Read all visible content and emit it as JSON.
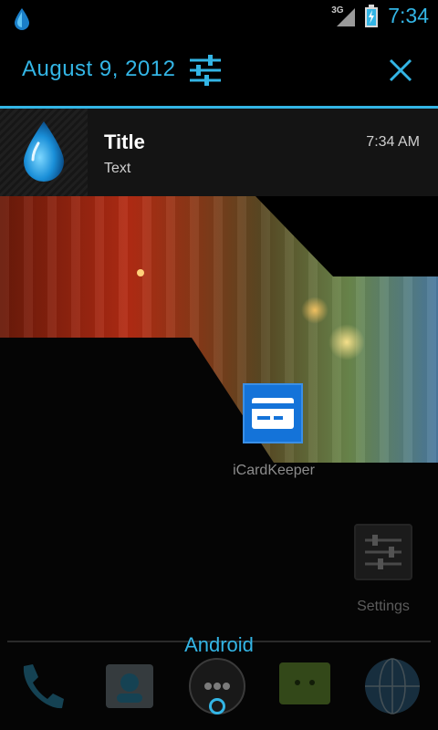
{
  "status_bar": {
    "network_label": "3G",
    "time": "7:34",
    "accent_color": "#33b5e5"
  },
  "notification_shade": {
    "date": "August 9, 2012",
    "settings_icon": "sliders-icon",
    "clear_icon": "close-icon",
    "notification": {
      "icon": "water-drop-icon",
      "title": "Title",
      "text": "Text",
      "time": "7:34 AM"
    }
  },
  "home_screen": {
    "shortcuts": [
      {
        "label": "iCardKeeper",
        "icon": "card-icon"
      },
      {
        "label": "Settings",
        "icon": "settings-sliders-icon"
      }
    ],
    "page_label": "Android",
    "dock_icons": [
      "phone-icon",
      "contacts-icon",
      "apps-icon",
      "messaging-icon",
      "browser-icon"
    ]
  }
}
